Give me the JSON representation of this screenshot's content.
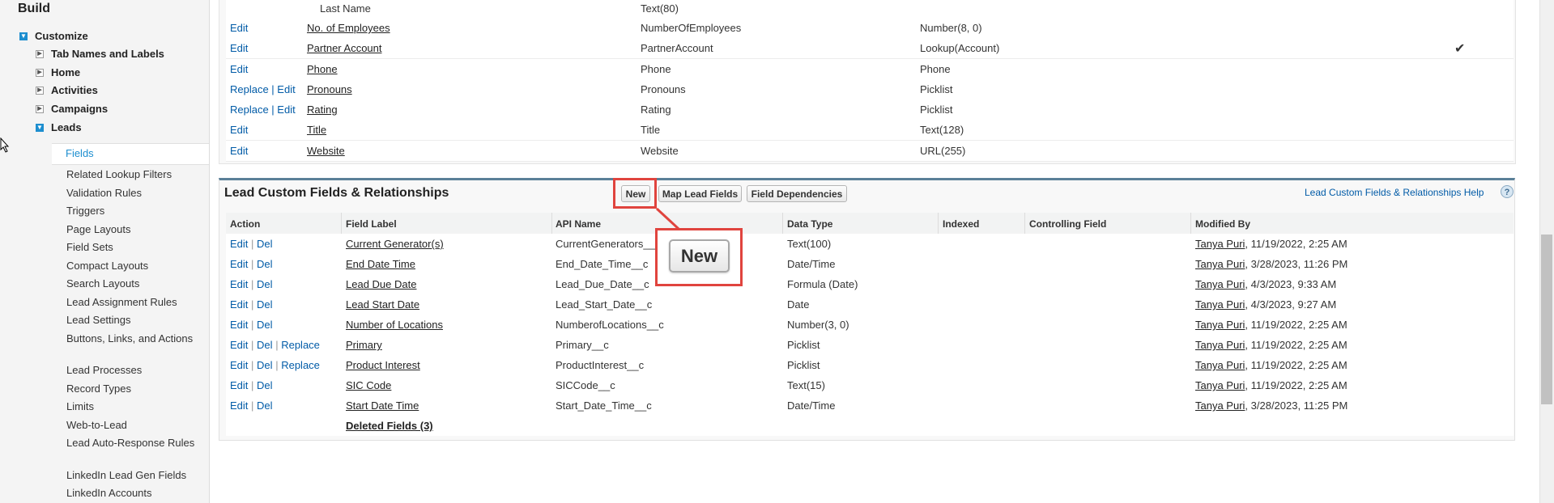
{
  "sidebar": {
    "section_title": "Build",
    "customize": "Customize",
    "items": [
      {
        "label": "Tab Names and Labels"
      },
      {
        "label": "Home"
      },
      {
        "label": "Activities"
      },
      {
        "label": "Campaigns"
      },
      {
        "label": "Leads"
      }
    ],
    "lead_subitems": [
      "Fields",
      "Related Lookup Filters",
      "Validation Rules",
      "Triggers",
      "Page Layouts",
      "Field Sets",
      "Compact Layouts",
      "Search Layouts",
      "Lead Assignment Rules",
      "Lead Settings",
      "Buttons, Links, and Actions",
      "Lead Processes",
      "Record Types",
      "Limits",
      "Web-to-Lead",
      "Lead Auto-Response Rules",
      "LinkedIn Lead Gen Fields",
      "LinkedIn Accounts"
    ]
  },
  "standard_fields": [
    {
      "action": "",
      "label": "Last Name",
      "api": "",
      "type": "Text(80)",
      "controlling": ""
    },
    {
      "action": "Edit",
      "label": "No. of Employees",
      "api": "NumberOfEmployees",
      "type": "Number(8, 0)",
      "controlling": ""
    },
    {
      "action": "Edit",
      "label": "Partner Account",
      "api": "PartnerAccount",
      "type": "Lookup(Account)",
      "controlling": "✔"
    },
    {
      "action": "Edit",
      "label": "Phone",
      "api": "Phone",
      "type": "Phone",
      "controlling": ""
    },
    {
      "action": "Replace | Edit",
      "label": "Pronouns",
      "api": "Pronouns",
      "type": "Picklist",
      "controlling": ""
    },
    {
      "action": "Replace | Edit",
      "label": "Rating",
      "api": "Rating",
      "type": "Picklist",
      "controlling": ""
    },
    {
      "action": "Edit",
      "label": "Title",
      "api": "Title",
      "type": "Text(128)",
      "controlling": ""
    },
    {
      "action": "Edit",
      "label": "Website",
      "api": "Website",
      "type": "URL(255)",
      "controlling": ""
    }
  ],
  "custom_section": {
    "title": "Lead Custom Fields & Relationships",
    "buttons": {
      "new": "New",
      "map": "Map Lead Fields",
      "deps": "Field Dependencies"
    },
    "help_link": "Lead Custom Fields & Relationships Help",
    "help_icon": "?",
    "headers": [
      "Action",
      "Field Label",
      "API Name",
      "Data Type",
      "Indexed",
      "Controlling Field",
      "Modified By"
    ],
    "rows": [
      {
        "actions": [
          "Edit",
          "Del"
        ],
        "label": "Current Generator(s)",
        "api": "CurrentGenerators__c",
        "type": "Text(100)",
        "user": "Tanya Puri",
        "date": ", 11/19/2022, 2:25 AM"
      },
      {
        "actions": [
          "Edit",
          "Del"
        ],
        "label": "End Date Time",
        "api": "End_Date_Time__c",
        "type": "Date/Time",
        "user": "Tanya Puri",
        "date": ", 3/28/2023, 11:26 PM"
      },
      {
        "actions": [
          "Edit",
          "Del"
        ],
        "label": "Lead Due Date",
        "api": "Lead_Due_Date__c",
        "type": "Formula (Date)",
        "user": "Tanya Puri",
        "date": ", 4/3/2023, 9:33 AM"
      },
      {
        "actions": [
          "Edit",
          "Del"
        ],
        "label": "Lead Start Date",
        "api": "Lead_Start_Date__c",
        "type": "Date",
        "user": "Tanya Puri",
        "date": ", 4/3/2023, 9:27 AM"
      },
      {
        "actions": [
          "Edit",
          "Del"
        ],
        "label": "Number of Locations",
        "api": "NumberofLocations__c",
        "type": "Number(3, 0)",
        "user": "Tanya Puri",
        "date": ", 11/19/2022, 2:25 AM"
      },
      {
        "actions": [
          "Edit",
          "Del",
          "Replace"
        ],
        "label": "Primary",
        "api": "Primary__c",
        "type": "Picklist",
        "user": "Tanya Puri",
        "date": ", 11/19/2022, 2:25 AM"
      },
      {
        "actions": [
          "Edit",
          "Del",
          "Replace"
        ],
        "label": "Product Interest",
        "api": "ProductInterest__c",
        "type": "Picklist",
        "user": "Tanya Puri",
        "date": ", 11/19/2022, 2:25 AM"
      },
      {
        "actions": [
          "Edit",
          "Del"
        ],
        "label": "SIC Code",
        "api": "SICCode__c",
        "type": "Text(15)",
        "user": "Tanya Puri",
        "date": ", 11/19/2022, 2:25 AM"
      },
      {
        "actions": [
          "Edit",
          "Del"
        ],
        "label": "Start Date Time",
        "api": "Start_Date_Time__c",
        "type": "Date/Time",
        "user": "Tanya Puri",
        "date": ", 3/28/2023, 11:25 PM"
      }
    ],
    "deleted_fields": "Deleted Fields (3)"
  },
  "callout": {
    "label": "New"
  },
  "colors": {
    "highlight": "#e0443e",
    "link": "#015ba7",
    "accent": "#1d8ecf"
  }
}
